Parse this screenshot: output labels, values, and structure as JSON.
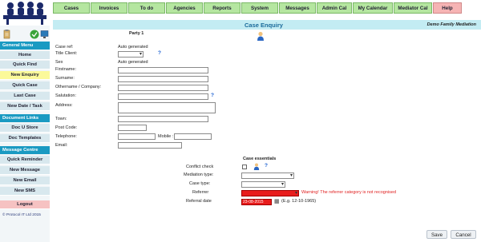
{
  "nav": {
    "tabs": [
      {
        "label": "Cases"
      },
      {
        "label": "Invoices"
      },
      {
        "label": "To do"
      },
      {
        "label": "Agencies"
      },
      {
        "label": "Reports"
      },
      {
        "label": "System"
      },
      {
        "label": "Messages"
      },
      {
        "label": "Admin Cal"
      },
      {
        "label": "My Calendar"
      },
      {
        "label": "Mediator Cal"
      },
      {
        "label": "Help"
      }
    ]
  },
  "sidebar": {
    "general_title": "General Menu",
    "general_items": [
      {
        "label": "Home"
      },
      {
        "label": "Quick Find"
      },
      {
        "label": "New Enquiry"
      },
      {
        "label": "Quick Case"
      },
      {
        "label": "Last Case"
      },
      {
        "label": "New Date / Task"
      }
    ],
    "document_title": "Document Links",
    "document_items": [
      {
        "label": "Doc U Store"
      },
      {
        "label": "Doc Templates"
      }
    ],
    "message_title": "Message Centre",
    "message_items": [
      {
        "label": "Quick Reminder"
      },
      {
        "label": "New Message"
      },
      {
        "label": "New Email"
      },
      {
        "label": "New SMS"
      }
    ],
    "logout_label": "Logout",
    "copyright": "© Protocol IT Ltd 2015",
    "active_color": "#fbf99a",
    "header_color": "#1a9ac2"
  },
  "header": {
    "title": "Case Enquiry",
    "organisation": "Demo Family Mediation"
  },
  "party": {
    "heading": "Party 1",
    "case_ref_label": "Case ref:",
    "case_ref_value": "Auto generated",
    "title_client_label": "Title Client:",
    "title_client_value": "",
    "sex_label": "Sex",
    "sex_value": "Auto generated",
    "firstname_label": "Firstname:",
    "surname_label": "Surname:",
    "othername_label": "Othername / Company:",
    "salutation_label": "Salutation:",
    "address_label": "Address:",
    "town_label": "Town:",
    "postcode_label": "Post Code:",
    "telephone_label": "Telephone:",
    "mobile_label": "Mobile :",
    "email_label": "Email:"
  },
  "essentials": {
    "heading": "Case essentials",
    "conflict_label": "Conflict check",
    "mediation_type_label": "Mediation type:",
    "case_type_label": "Case type:",
    "referrer_label": "Referrer",
    "referrer_warning": "Warning! The referrer category is not recognised",
    "referral_date_label": "Referral date",
    "referral_date_value": "23-08-2015",
    "date_hint": "(E.g. 12-10-1965)",
    "error_color": "#e81c1c"
  },
  "help_mark": "?",
  "buttons": {
    "save": "Save",
    "cancel": "Cancel"
  }
}
